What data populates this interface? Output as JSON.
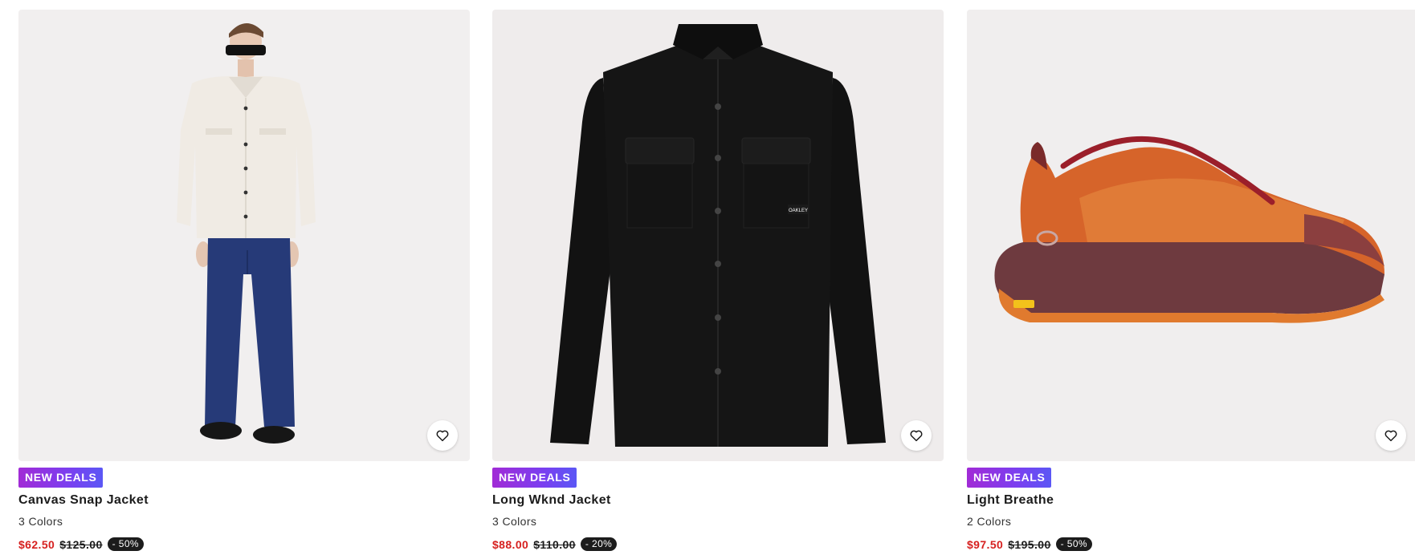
{
  "products": [
    {
      "badge": "NEW DEALS",
      "name": "Canvas Snap Jacket",
      "colors": "3 Colors",
      "sale_price": "$62.50",
      "original_price": "$125.00",
      "discount": "- 50%",
      "image": "model wearing off-white canvas jacket and navy pants",
      "wishlist_icon": "heart-icon"
    },
    {
      "badge": "NEW DEALS",
      "name": "Long Wknd Jacket",
      "colors": "3 Colors",
      "sale_price": "$88.00",
      "original_price": "$110.00",
      "discount": "- 20%",
      "image": "black button-up jacket with chest pockets",
      "wishlist_icon": "heart-icon"
    },
    {
      "badge": "NEW DEALS",
      "name": "Light Breathe",
      "colors": "2 Colors",
      "sale_price": "$97.50",
      "original_price": "$195.00",
      "discount": "- 50%",
      "image": "orange and burgundy trail running shoe",
      "wishlist_icon": "heart-icon"
    }
  ],
  "colors": {
    "sale_price": "#d6201f",
    "badge_gradient_start": "#a12bd6",
    "badge_gradient_end": "#5b57f5",
    "discount_pill": "#1c1c1c"
  }
}
